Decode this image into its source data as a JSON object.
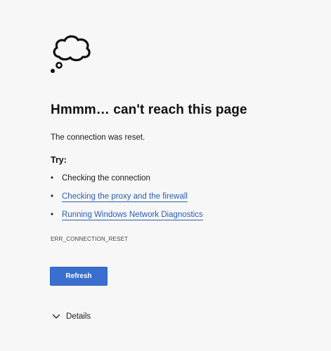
{
  "icon": "thought-bubble-icon",
  "title": "Hmmm… can't reach this page",
  "message": "The connection was reset.",
  "try_heading": "Try:",
  "suggestions": [
    {
      "label": "Checking the connection",
      "is_link": false
    },
    {
      "label": "Checking the proxy and the firewall",
      "is_link": true
    },
    {
      "label": "Running Windows Network Diagnostics",
      "is_link": true
    }
  ],
  "error_code": "ERR_CONNECTION_RESET",
  "refresh_label": "Refresh",
  "details_label": "Details",
  "details_icon": "chevron-down-icon",
  "colors": {
    "background": "#f7f7f7",
    "link": "#2a5db0",
    "button": "#3a6fcf",
    "button_text": "#ffffff"
  }
}
